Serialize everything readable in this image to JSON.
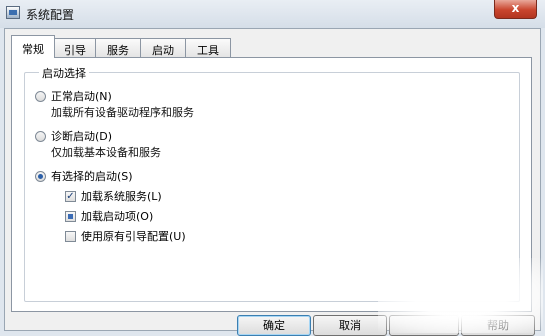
{
  "window": {
    "title": "系统配置",
    "close_glyph": "x"
  },
  "tabs": [
    {
      "label": "常规",
      "active": true
    },
    {
      "label": "引导",
      "active": false
    },
    {
      "label": "服务",
      "active": false
    },
    {
      "label": "启动",
      "active": false
    },
    {
      "label": "工具",
      "active": false
    }
  ],
  "startup": {
    "group_label": "启动选择",
    "normal": {
      "label": "正常启动(N)",
      "description": "加载所有设备驱动程序和服务",
      "selected": false
    },
    "diagnostic": {
      "label": "诊断启动(D)",
      "description": "仅加载基本设备和服务",
      "selected": false
    },
    "selective": {
      "label": "有选择的启动(S)",
      "selected": true,
      "options": [
        {
          "label": "加载系统服务(L)",
          "state": "checked",
          "glyph": "✓"
        },
        {
          "label": "加载启动项(O)",
          "state": "indeterminate"
        },
        {
          "label": "使用原有引导配置(U)",
          "state": "unchecked"
        }
      ]
    }
  },
  "buttons": {
    "ok": "确定",
    "cancel": "取消",
    "help": "帮助"
  }
}
